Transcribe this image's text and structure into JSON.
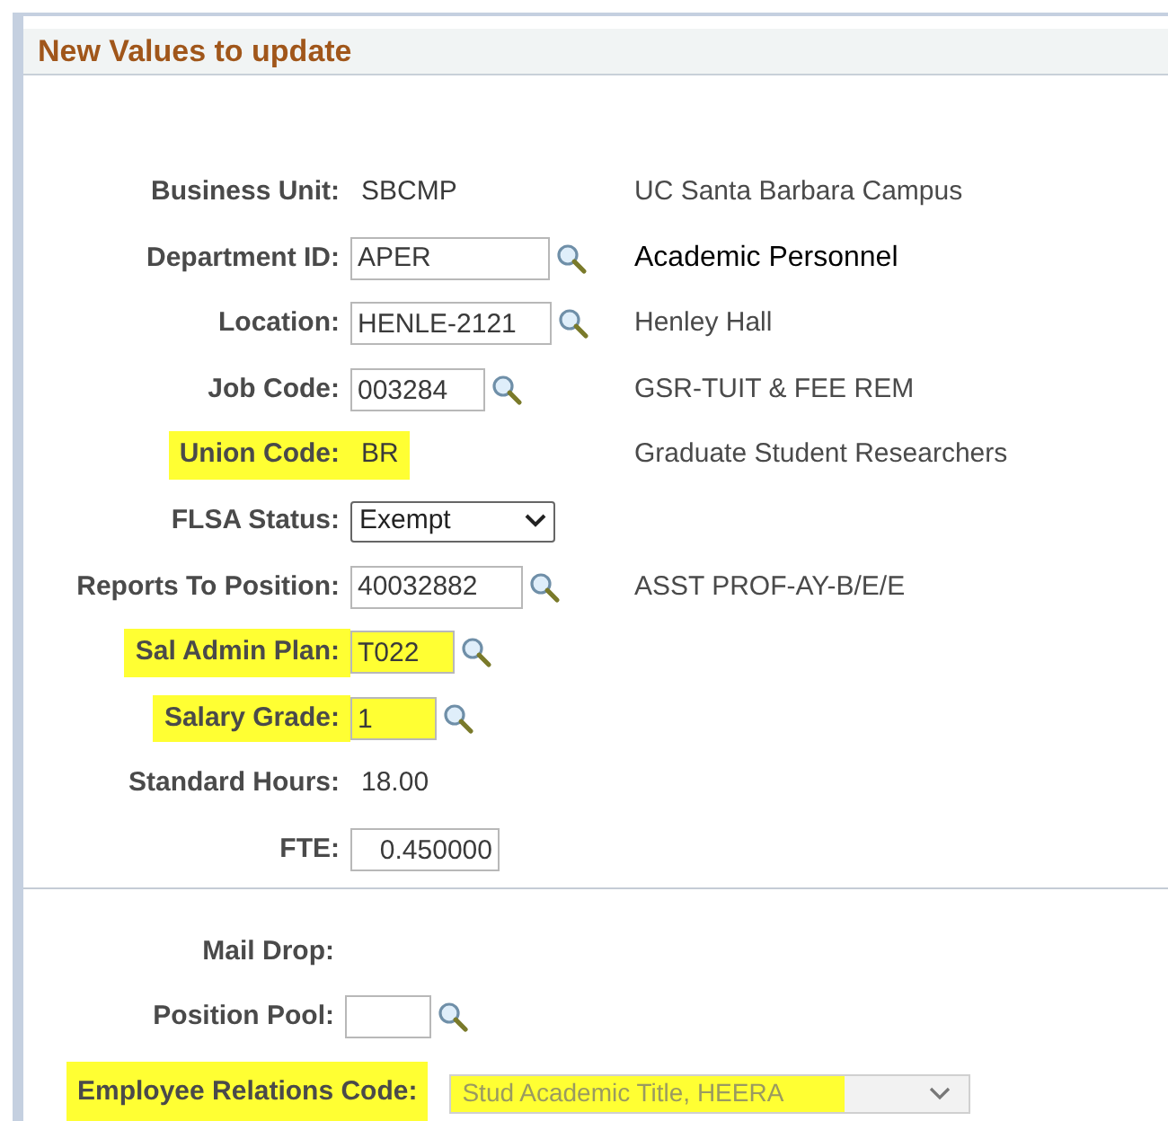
{
  "section": {
    "title": "New Values to update"
  },
  "fields": [
    {
      "label": "Business Unit:",
      "kind": "text",
      "value": "SBCMP",
      "description": "UC Santa Barbara Campus",
      "highlighted": false
    },
    {
      "label": "Department ID:",
      "kind": "lookup",
      "value": "APER",
      "description": "Academic Personnel",
      "highlighted": false
    },
    {
      "label": "Location:",
      "kind": "lookup",
      "value": "HENLE-2121",
      "description": "Henley Hall",
      "highlighted": false
    },
    {
      "label": "Job Code:",
      "kind": "lookup",
      "value": "003284",
      "description": "GSR-TUIT & FEE REM",
      "highlighted": false
    },
    {
      "label": "Union Code:",
      "kind": "text",
      "value": "BR",
      "description": "Graduate Student Researchers",
      "highlighted": true
    },
    {
      "label": "FLSA Status:",
      "kind": "select",
      "value": "Exempt",
      "highlighted": false
    },
    {
      "label": "Reports To Position:",
      "kind": "lookup",
      "value": "40032882",
      "description": "ASST PROF-AY-B/E/E",
      "highlighted": false
    },
    {
      "label": "Sal Admin Plan:",
      "kind": "lookup",
      "value": "T022",
      "highlighted": true
    },
    {
      "label": "Salary Grade:",
      "kind": "lookup",
      "value": "1",
      "highlighted": true
    },
    {
      "label": "Standard Hours:",
      "kind": "text",
      "value": "18.00",
      "highlighted": false
    },
    {
      "label": "FTE:",
      "kind": "input",
      "value": "0.450000",
      "highlighted": false
    }
  ],
  "other_fields": [
    {
      "label": "Mail Drop:",
      "kind": "text",
      "highlighted": false
    },
    {
      "label": "Position Pool:",
      "kind": "lookup",
      "highlighted": false
    },
    {
      "label": "Employee Relations Code:",
      "kind": "disabled_select",
      "value": "Stud Academic Title, HEERA",
      "highlighted": true
    }
  ]
}
